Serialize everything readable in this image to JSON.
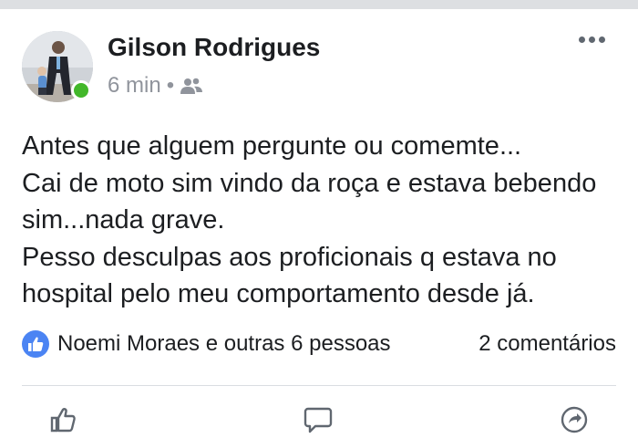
{
  "post": {
    "author_name": "Gilson Rodrigues",
    "timestamp": "6 min",
    "separator": "•",
    "audience_icon": "friends-icon",
    "more_icon": "more-options-icon",
    "online_status_color": "#42b72a",
    "text": "Antes que alguem pergunte ou comemte...\nCai de moto sim vindo da roça  e estava bebendo sim...nada grave.\nPesso desculpas aos proficionais q estava no hospital pelo meu comportamento desde já.",
    "reactions": {
      "icon": "like-icon",
      "color": "#4b84f3",
      "summary": "Noemi Moraes e outras 6 pessoas"
    },
    "comments_count": "2 comentários"
  },
  "actions": [
    {
      "icon": "thumbs-up-icon"
    },
    {
      "icon": "comment-icon"
    },
    {
      "icon": "share-icon"
    }
  ]
}
